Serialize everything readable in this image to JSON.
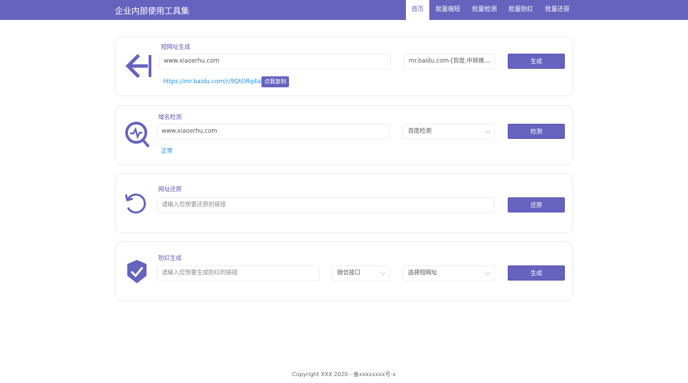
{
  "header": {
    "title": "企业内部使用工具集",
    "nav": [
      {
        "label": "首页",
        "active": true
      },
      {
        "label": "批量缩短"
      },
      {
        "label": "批量检测"
      },
      {
        "label": "批量防红"
      },
      {
        "label": "批量还原"
      }
    ]
  },
  "short_url": {
    "title": "短网址生成",
    "input_value": "www.xiaoerhu.com",
    "select_value": "mr.baidu.com-[百度,中转跳...",
    "button": "生成",
    "result_link": "https://mr.baidu.com/r/9QtORq4asM",
    "copy_button": "点我复制",
    "icon": "arrow-left-bar-icon"
  },
  "domain_check": {
    "title": "域名检测",
    "input_value": "www.xiaoerhu.com",
    "select_value": "百度检测",
    "button": "检测",
    "status": "正常",
    "icon": "search-pulse-icon"
  },
  "url_restore": {
    "title": "网址还原",
    "input_placeholder": "请输入您想要还原的链接",
    "button": "还原",
    "icon": "undo-icon"
  },
  "anti_red": {
    "title": "防红生成",
    "input_placeholder": "请输入您想要生成防红的链接",
    "select_api": "微信接口",
    "select_short": "选择短网址",
    "button": "生成",
    "icon": "shield-check-icon"
  },
  "footer": {
    "copyright": "Copyright XXX 2020 - 备xxxxxxxx号-x"
  },
  "colors": {
    "primary": "#6663bf",
    "link": "#1f8ef5"
  }
}
